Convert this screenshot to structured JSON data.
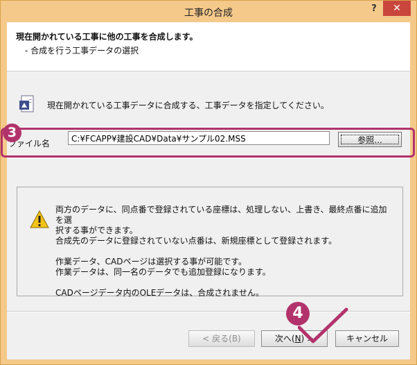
{
  "window": {
    "title": "工事の合成",
    "help": "?",
    "close": "✕"
  },
  "header": {
    "title": "現在開かれている工事に他の工事を合成します。",
    "subtitle": "- 合成を行う工事データの選択"
  },
  "instruction": {
    "icon": "document-icon",
    "text": "現在開かれている工事データに合成する、工事データを指定してください。"
  },
  "file": {
    "label": "ファイル名",
    "value": "C:¥FCAPP¥建設CAD¥Data¥サンプル02.MSS",
    "browse_label": "参照..."
  },
  "info": {
    "icon": "warning-icon",
    "paragraphs": [
      "両方のデータに、同点番で登録されている座標は、処理しない、上書き、最終点番に追加を選\n択する事ができます。\n合成先のデータに登録されていない点番は、新規座標として登録されます。",
      "作業データ、CADページは選択する事が可能です。\n作業データは、同一名のデータでも追加登録になります。",
      "CADページデータ内のOLEデータは、合成されません。"
    ]
  },
  "buttons": {
    "back_label": "< 戻る(B)",
    "next_text": "次へ(",
    "next_key": "N",
    "next_suffix": ") >",
    "cancel_label": "キャンセル"
  },
  "annotations": {
    "step3": "3",
    "step4": "4",
    "color": "#b2336c"
  }
}
